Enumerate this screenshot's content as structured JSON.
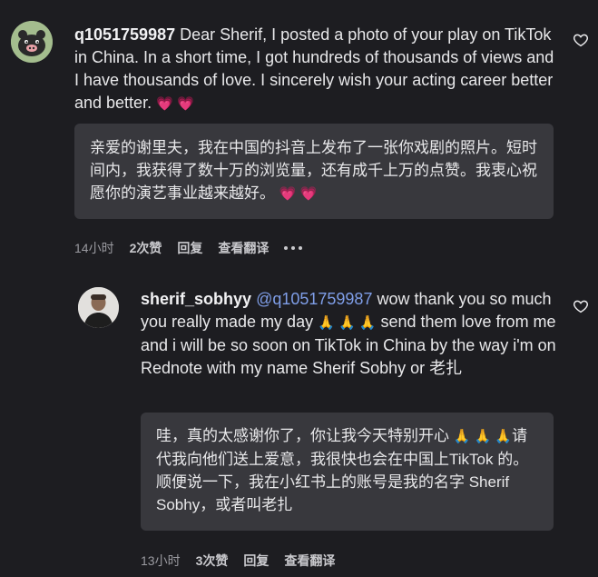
{
  "comment1": {
    "username": "q1051759987",
    "text": "Dear Sherif, I posted a photo of your play on TikTok in China. In a short time, I got hundreds of thousands of views and I have thousands of love. I sincerely wish your acting career better and better.",
    "emoji": "💗 💗",
    "translation": "亲爱的谢里夫，我在中国的抖音上发布了一张你戏剧的照片。短时间内，我获得了数十万的浏览量，还有成千上万的点赞。我衷心祝愿你的演艺事业越来越好。",
    "translation_emoji": "💗 💗",
    "time": "14小时",
    "likes": "2次赞",
    "reply": "回复",
    "view_translation": "查看翻译",
    "avatar_icon": "cartoon-pig-icon"
  },
  "comment2": {
    "username": "sherif_sobhyy",
    "mention": "@q1051759987",
    "text_part1": " wow thank you so much you really made my day",
    "emoji1": "🙏 🙏 🙏",
    "text_part2": " send them love from me and i will be so soon on TikTok in China by the way i'm on Rednote with my name Sherif Sobhy or 老扎",
    "translation_part1": "哇，真的太感谢你了，你让我今天特别开心",
    "translation_emoji": "🙏 🙏 🙏",
    "translation_part2": "请代我向他们送上爱意，我很快也会在中国上TikTok 的。顺便说一下，我在小红书上的账号是我的名字 Sherif Sobhy，或者叫老扎",
    "time": "13小时",
    "likes": "3次赞",
    "reply": "回复",
    "view_translation": "查看翻译",
    "avatar_icon": "user-photo-icon"
  },
  "colors": {
    "background": "#1d1d21",
    "translation_box": "#38383d",
    "mention": "#7f9ee8",
    "heart_emoji": "#e83e6c"
  }
}
